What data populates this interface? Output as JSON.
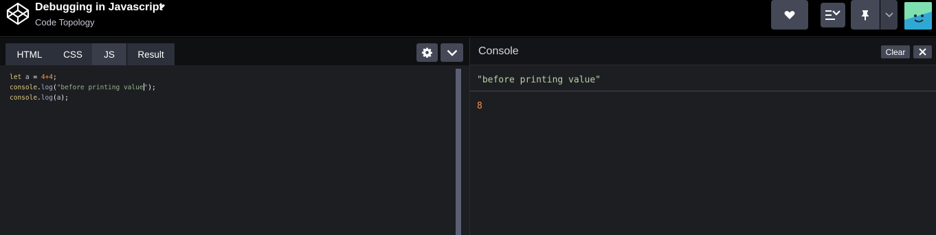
{
  "header": {
    "title": "Debugging in Javascript",
    "author": "Code Topology",
    "buttons": {
      "like": "heart-icon",
      "collections": "list-chevron-icon",
      "pin": "pin-icon",
      "pin_menu": "chevron-down-icon"
    }
  },
  "editor": {
    "tabs": [
      {
        "label": "HTML"
      },
      {
        "label": "CSS"
      },
      {
        "label": "JS"
      },
      {
        "label": "Result"
      }
    ],
    "active_tab": "JS",
    "code_lines": [
      "let a = 4+4;",
      "console.log(\"before printing value\");",
      "console.log(a);"
    ]
  },
  "console": {
    "title": "Console",
    "clear_label": "Clear",
    "logs": [
      "\"before printing value\"",
      "8"
    ]
  },
  "colors": {
    "background": "#000000",
    "panel": "#1d1e22",
    "button": "#444857",
    "string": "#96b38a",
    "number": "#ff8c4a",
    "keyword": "#ddca7e"
  }
}
